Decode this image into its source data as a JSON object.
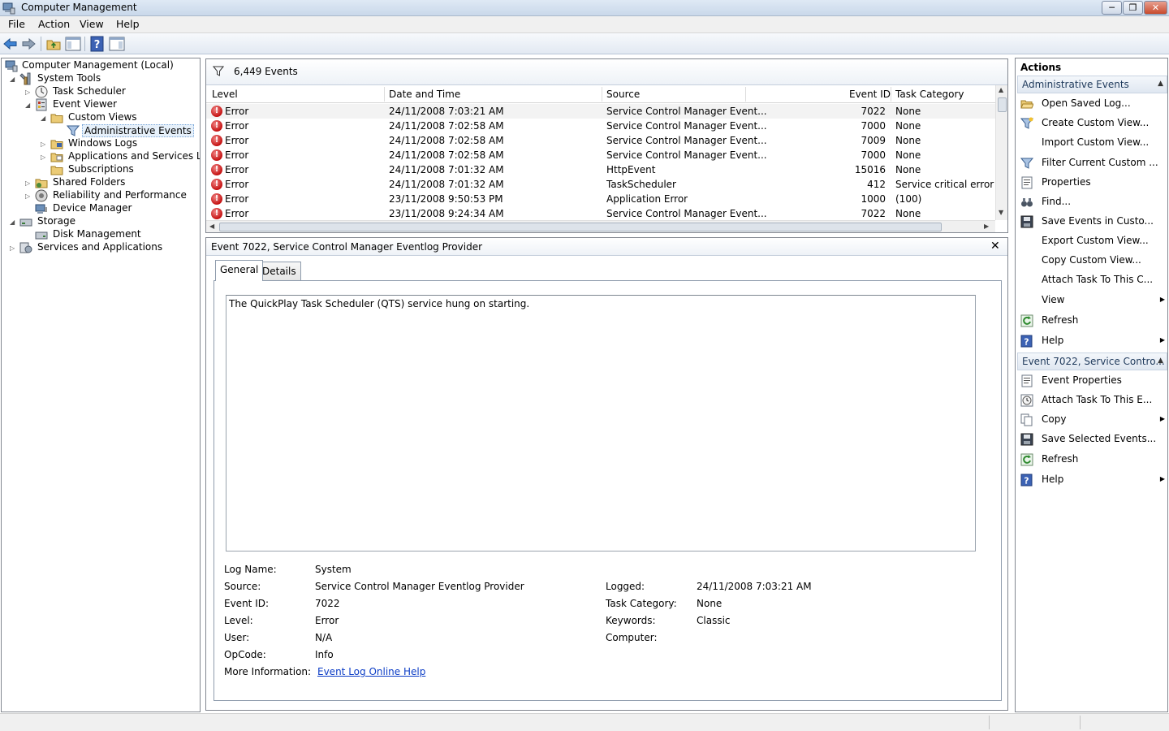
{
  "window": {
    "title": "Computer Management"
  },
  "menu": [
    "File",
    "Action",
    "View",
    "Help"
  ],
  "toolbar": {
    "buttons": [
      "back-arrow-icon",
      "forward-arrow-icon",
      "up-folder-icon",
      "show-hide-console-tree-icon",
      "help-icon",
      "show-hide-action-pane-icon"
    ]
  },
  "tree": {
    "root": "Computer Management (Local)",
    "system_tools": "System Tools",
    "task_scheduler": "Task Scheduler",
    "event_viewer": "Event Viewer",
    "custom_views": "Custom Views",
    "administrative_events": "Administrative Events",
    "windows_logs": "Windows Logs",
    "app_services_logs": "Applications and Services Logs",
    "subscriptions": "Subscriptions",
    "shared_folders": "Shared Folders",
    "reliability": "Reliability and Performance",
    "device_manager": "Device Manager",
    "storage": "Storage",
    "disk_management": "Disk Management",
    "services_apps": "Services and Applications"
  },
  "events": {
    "count_label": "6,449 Events",
    "columns": [
      "Level",
      "Date and Time",
      "Source",
      "Event ID",
      "Task Category"
    ],
    "rows": [
      {
        "level": "Error",
        "date": "24/11/2008 7:03:21 AM",
        "source": "Service Control Manager Event...",
        "id": "7022",
        "category": "None"
      },
      {
        "level": "Error",
        "date": "24/11/2008 7:02:58 AM",
        "source": "Service Control Manager Event...",
        "id": "7000",
        "category": "None"
      },
      {
        "level": "Error",
        "date": "24/11/2008 7:02:58 AM",
        "source": "Service Control Manager Event...",
        "id": "7009",
        "category": "None"
      },
      {
        "level": "Error",
        "date": "24/11/2008 7:02:58 AM",
        "source": "Service Control Manager Event...",
        "id": "7000",
        "category": "None"
      },
      {
        "level": "Error",
        "date": "24/11/2008 7:01:32 AM",
        "source": "HttpEvent",
        "id": "15016",
        "category": "None"
      },
      {
        "level": "Error",
        "date": "24/11/2008 7:01:32 AM",
        "source": "TaskScheduler",
        "id": "412",
        "category": "Service critical error"
      },
      {
        "level": "Error",
        "date": "23/11/2008 9:50:53 PM",
        "source": "Application Error",
        "id": "1000",
        "category": "(100)"
      },
      {
        "level": "Error",
        "date": "23/11/2008 9:24:34 AM",
        "source": "Service Control Manager Event...",
        "id": "7022",
        "category": "None"
      }
    ]
  },
  "detail": {
    "title": "Event 7022, Service Control Manager Eventlog Provider",
    "tabs": [
      "General",
      "Details"
    ],
    "description": "The QuickPlay Task Scheduler (QTS) service hung on starting.",
    "labels": {
      "log_name": "Log Name:",
      "source": "Source:",
      "event_id": "Event ID:",
      "level": "Level:",
      "user": "User:",
      "opcode": "OpCode:",
      "more_info": "More Information:",
      "logged": "Logged:",
      "task_category": "Task Category:",
      "keywords": "Keywords:",
      "computer": "Computer:"
    },
    "values": {
      "log_name": "System",
      "source": "Service Control Manager Eventlog Provider",
      "event_id": "7022",
      "level": "Error",
      "user": "N/A",
      "opcode": "Info",
      "more_info": "Event Log Online Help",
      "logged": "24/11/2008 7:03:21 AM",
      "task_category": "None",
      "keywords": "Classic",
      "computer": ""
    }
  },
  "actions": {
    "title": "Actions",
    "section1": "Administrative Events",
    "section1_items": [
      {
        "label": "Open Saved Log...",
        "icon": "open-folder-icon",
        "submenu": false
      },
      {
        "label": "Create Custom View...",
        "icon": "create-filter-icon",
        "submenu": false
      },
      {
        "label": "Import Custom View...",
        "icon": "",
        "submenu": false
      },
      {
        "label": "Filter Current Custom ...",
        "icon": "filter-icon",
        "submenu": false
      },
      {
        "label": "Properties",
        "icon": "properties-icon",
        "submenu": false
      },
      {
        "label": "Find...",
        "icon": "binoculars-icon",
        "submenu": false
      },
      {
        "label": "Save Events in Custo...",
        "icon": "save-icon",
        "submenu": false
      },
      {
        "label": "Export Custom View...",
        "icon": "",
        "submenu": false
      },
      {
        "label": "Copy Custom View...",
        "icon": "",
        "submenu": false
      },
      {
        "label": "Attach Task To This C...",
        "icon": "",
        "submenu": false
      },
      {
        "label": "View",
        "icon": "",
        "submenu": true
      },
      {
        "label": "Refresh",
        "icon": "refresh-icon",
        "submenu": false
      },
      {
        "label": "Help",
        "icon": "help-icon",
        "submenu": true
      }
    ],
    "section2": "Event 7022, Service Contro...",
    "section2_items": [
      {
        "label": "Event Properties",
        "icon": "properties-icon",
        "submenu": false
      },
      {
        "label": "Attach Task To This E...",
        "icon": "task-clock-icon",
        "submenu": false
      },
      {
        "label": "Copy",
        "icon": "copy-icon",
        "submenu": true
      },
      {
        "label": "Save Selected Events...",
        "icon": "save-icon",
        "submenu": false
      },
      {
        "label": "Refresh",
        "icon": "refresh-icon",
        "submenu": false
      },
      {
        "label": "Help",
        "icon": "help-icon",
        "submenu": true
      }
    ]
  }
}
